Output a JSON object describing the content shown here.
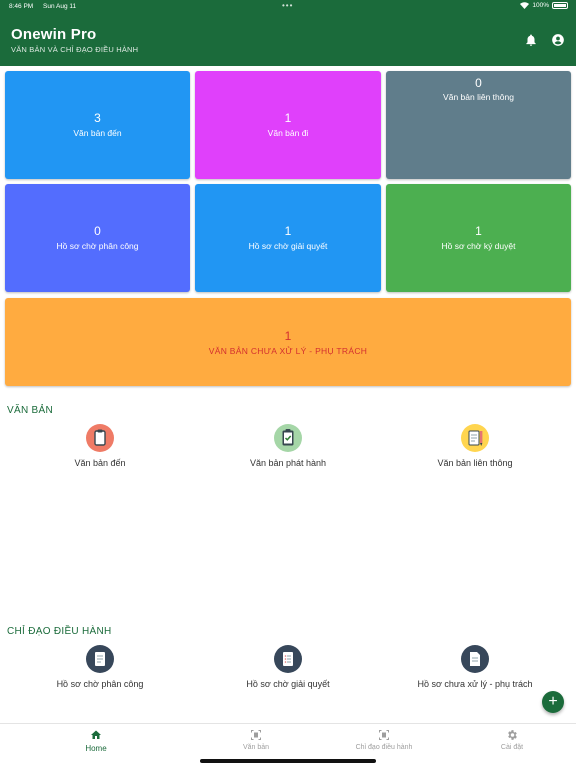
{
  "status_bar": {
    "time": "8:46 PM",
    "date": "Sun Aug 11",
    "dots": "•••",
    "battery": "100%"
  },
  "header": {
    "title": "Onewin Pro",
    "subtitle": "VĂN BẢN VÀ CHỈ ĐẠO ĐIỀU HÀNH"
  },
  "tiles": [
    {
      "count": "3",
      "label": "Văn bản đến",
      "color": "#2196f3"
    },
    {
      "count": "1",
      "label": "Văn bản đi",
      "color": "#e040fb"
    },
    {
      "count": "0",
      "label": "Văn bản liên thông",
      "color": "#607d8b"
    },
    {
      "count": "0",
      "label": "Hồ sơ chờ phân công",
      "color": "#536dfe"
    },
    {
      "count": "1",
      "label": "Hồ sơ chờ giải quyết",
      "color": "#2196f3"
    },
    {
      "count": "1",
      "label": "Hồ sơ chờ ký duyệt",
      "color": "#4caf50"
    }
  ],
  "wide_tile": {
    "count": "1",
    "label": "VĂN BẢN CHƯA XỬ LÝ - PHỤ TRÁCH",
    "color": "#ffab40"
  },
  "van_ban": {
    "title": "VĂN BẢN",
    "items": [
      {
        "label": "Văn bản đến",
        "icon": "clipboard-icon"
      },
      {
        "label": "Văn bản phát hành",
        "icon": "clipboard-check-icon"
      },
      {
        "label": "Văn bản liên thông",
        "icon": "notepad-pencil-icon"
      }
    ]
  },
  "chi_dao": {
    "title": "CHỈ ĐẠO ĐIỀU HÀNH",
    "items": [
      {
        "label": "Hồ sơ chờ phân công",
        "icon": "document-list-icon"
      },
      {
        "label": "Hồ sơ chờ giải quyết",
        "icon": "document-list-icon"
      },
      {
        "label": "Hồ sơ chưa xử lý - phụ trách",
        "icon": "document-icon"
      }
    ]
  },
  "fab": {
    "symbol": "+"
  },
  "bottom_nav": [
    {
      "label": "Home",
      "icon": "home-icon",
      "active": true
    },
    {
      "label": "Văn bản",
      "icon": "document-scan-icon",
      "active": false
    },
    {
      "label": "Chỉ đạo điều hành",
      "icon": "document-scan-icon",
      "active": false
    },
    {
      "label": "Cài đặt",
      "icon": "gear-icon",
      "active": false
    }
  ],
  "colors": {
    "primary": "#1b6b3b",
    "alert_text": "#d32f2f"
  }
}
